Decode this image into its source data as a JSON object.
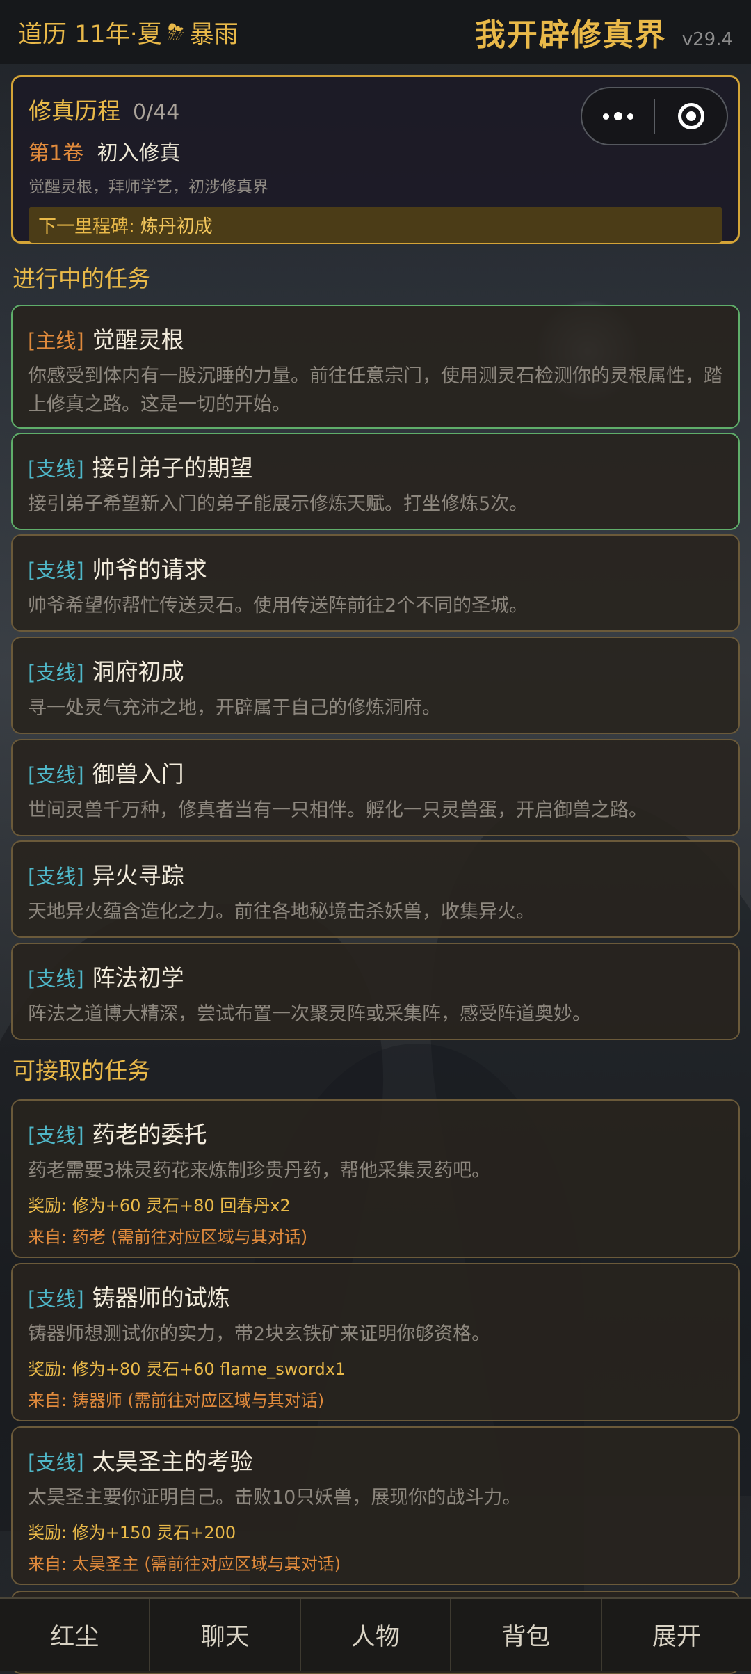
{
  "topbar": {
    "season": "道历 11年·夏",
    "weather_icon": "⛈",
    "weather": "暴雨",
    "app_title": "我开辟修真界",
    "version": "v29.4"
  },
  "progress": {
    "title": "修真历程",
    "count": "0/44",
    "volume": "第1卷",
    "chapter": "初入修真",
    "desc": "觉醒灵根，拜师学艺，初涉修真界",
    "milestone_label": "下一里程碑:",
    "milestone_value": "炼丹初成"
  },
  "capsule": {
    "more_icon": "more-dots-icon",
    "close_icon": "target-icon"
  },
  "sections": {
    "active": "进行中的任务",
    "available": "可接取的任务"
  },
  "active_quests": [
    {
      "tag": "[主线]",
      "name": "觉醒灵根",
      "desc": "你感受到体内有一股沉睡的力量。前往任意宗门，使用测灵石检测你的灵根属性，踏上修真之路。这是一切的开始。"
    },
    {
      "tag": "[支线]",
      "name": "接引弟子的期望",
      "desc": "接引弟子希望新入门的弟子能展示修炼天赋。打坐修炼5次。"
    },
    {
      "tag": "[支线]",
      "name": "帅爷的请求",
      "desc": "帅爷希望你帮忙传送灵石。使用传送阵前往2个不同的圣城。"
    },
    {
      "tag": "[支线]",
      "name": "洞府初成",
      "desc": "寻一处灵气充沛之地，开辟属于自己的修炼洞府。"
    },
    {
      "tag": "[支线]",
      "name": "御兽入门",
      "desc": "世间灵兽千万种，修真者当有一只相伴。孵化一只灵兽蛋，开启御兽之路。"
    },
    {
      "tag": "[支线]",
      "name": "异火寻踪",
      "desc": "天地异火蕴含造化之力。前往各地秘境击杀妖兽，收集异火。"
    },
    {
      "tag": "[支线]",
      "name": "阵法初学",
      "desc": "阵法之道博大精深，尝试布置一次聚灵阵或采集阵，感受阵道奥妙。"
    }
  ],
  "available_quests": [
    {
      "tag": "[支线]",
      "name": "药老的委托",
      "desc": "药老需要3株灵药花来炼制珍贵丹药，帮他采集灵药吧。",
      "reward": "奖励: 修为+60  灵石+80  回春丹x2",
      "from": "来自: 药老 (需前往对应区域与其对话)"
    },
    {
      "tag": "[支线]",
      "name": "铸器师的试炼",
      "desc": "铸器师想测试你的实力，带2块玄铁矿来证明你够资格。",
      "reward": "奖励: 修为+80  灵石+60  flame_swordx1",
      "from": "来自: 铸器师 (需前往对应区域与其对话)"
    },
    {
      "tag": "[支线]",
      "name": "太昊圣主的考验",
      "desc": "太昊圣主要你证明自己。击败10只妖兽，展现你的战斗力。",
      "reward": "奖励: 修为+150  灵石+200",
      "from": "来自: 太昊圣主 (需前往对应区域与其对话)"
    }
  ],
  "bottomnav": [
    "红尘",
    "聊天",
    "人物",
    "背包",
    "展开"
  ]
}
